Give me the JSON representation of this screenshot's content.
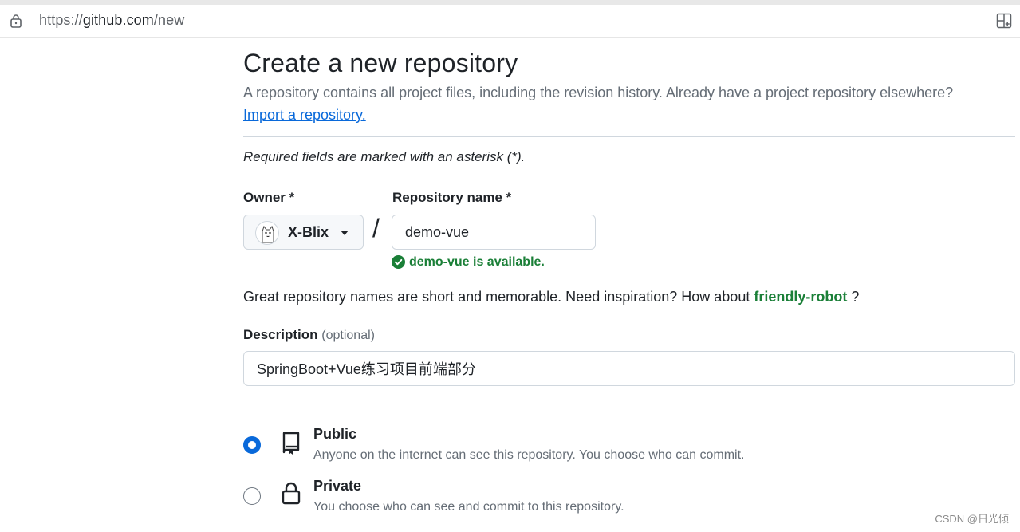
{
  "browser": {
    "url_prefix": "https://",
    "url_host": "github.com",
    "url_path": "/new",
    "icons": {
      "lock": "lock-icon",
      "tab": "tab-groups-icon"
    }
  },
  "page": {
    "title": "Create a new repository",
    "subtitle": "A repository contains all project files, including the revision history. Already have a project repository elsewhere?",
    "import_link": "Import a repository.",
    "required_note": "Required fields are marked with an asterisk (*)."
  },
  "owner": {
    "label": "Owner *",
    "selected": "X-Blix"
  },
  "repository": {
    "label": "Repository name *",
    "value": "demo-vue",
    "availability": "demo-vue is available.",
    "availability_color": "#1a7f37"
  },
  "inspiration": {
    "text": "Great repository names are short and memorable. Need inspiration? How about",
    "suggestion": "friendly-robot",
    "trailing": "?"
  },
  "description": {
    "label": "Description",
    "optional": "(optional)",
    "value": "SpringBoot+Vue练习项目前端部分"
  },
  "visibility": {
    "options": [
      {
        "title": "Public",
        "desc": "Anyone on the internet can see this repository. You choose who can commit.",
        "checked": true,
        "icon": "repo-icon"
      },
      {
        "title": "Private",
        "desc": "You choose who can see and commit to this repository.",
        "checked": false,
        "icon": "lock-icon"
      }
    ]
  },
  "watermark": "CSDN @日光倾",
  "colors": {
    "accent": "#0969da",
    "success": "#1a7f37",
    "muted": "#656d76"
  }
}
